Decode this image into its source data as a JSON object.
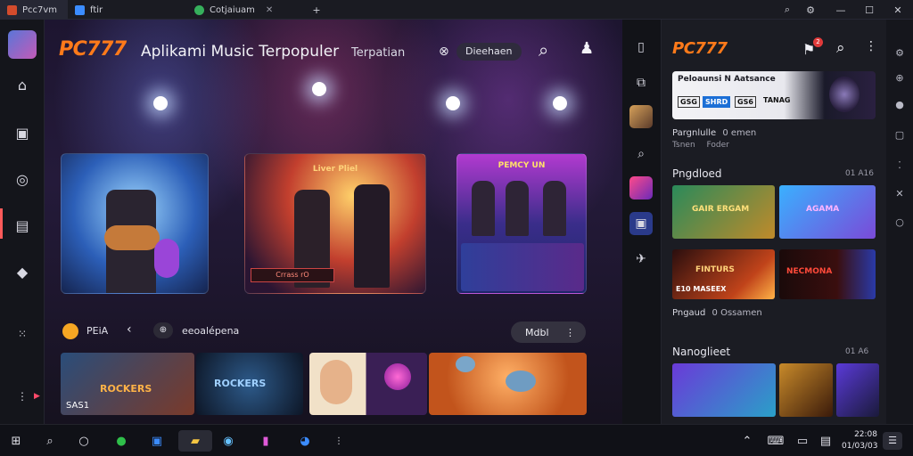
{
  "browser": {
    "tabs": [
      {
        "label": "Pcc7vm",
        "active": true
      },
      {
        "label": "ftir",
        "active": false
      },
      {
        "label": "Cotjaiuam",
        "active": false
      }
    ],
    "new_tab_icon": "plus-icon"
  },
  "window_controls": {
    "search": "search-icon",
    "settings": "gear-icon",
    "minimize": "minimize-icon",
    "maximize": "maximize-icon",
    "close": "close-icon"
  },
  "main": {
    "brand": "PC777",
    "title": "Aplikami Music Terpopuler",
    "subtitle_link": "Terpatian",
    "pill_label": "Dieehaen",
    "featured": [
      {
        "title": "",
        "name": "banner-guitarist"
      },
      {
        "title": "Liver Pliel",
        "footer": "Crrass rO",
        "name": "banner-concert"
      },
      {
        "title": "PEMCY UN",
        "name": "banner-band"
      }
    ],
    "filter_bar": {
      "category_label": "PEiA",
      "chip_label": "eeoalépena",
      "more_button": "Mdbl"
    },
    "tiles": [
      {
        "name": "tile-rockers",
        "title": "ROCKERS",
        "badge": "SAS1"
      },
      {
        "name": "tile-rock-concert",
        "title": "ROCKERS"
      },
      {
        "name": "tile-cartoon"
      },
      {
        "name": "tile-orange-creature"
      }
    ]
  },
  "panel": {
    "brand": "PC777",
    "notification_count": "2",
    "promo": {
      "headline": "Peloaunsi N Aatsance",
      "chips": [
        "GSG",
        "SHRD",
        "GS6",
        "TANAG"
      ]
    },
    "meta_row_1": {
      "line1": "Pargnlulle",
      "extra": "0 emen",
      "line2": "Tsnen",
      "line3": "Foder"
    },
    "sections": [
      {
        "title": "Pngdloed",
        "meta": "01 A16"
      },
      {
        "title": "Nanoglieet",
        "meta": "01 A6"
      }
    ],
    "tiles_row1": [
      {
        "name": "tile-game-remix",
        "title": "GAIR ERGAM"
      },
      {
        "name": "tile-blue-fantasy",
        "title": "AGAMA"
      }
    ],
    "tiles_row2": [
      {
        "name": "tile-fire-fights",
        "title": "FINTURS",
        "sub": "E10 MASEEX"
      },
      {
        "name": "tile-red-monster",
        "title": "NECMONA"
      }
    ],
    "meta_row_2": {
      "line1": "Pngaud",
      "extra": "0 Ossamen"
    },
    "tiles_row3": [
      {
        "name": "tile-heroes"
      },
      {
        "name": "tile-warrior"
      },
      {
        "name": "tile-hooded"
      }
    ]
  },
  "taskbar": {
    "clock_time": "22:08",
    "clock_date": "01/03/03",
    "apps": [
      "windows-icon",
      "search-icon",
      "circle-icon",
      "chrome-icon",
      "store-icon",
      "folder-icon",
      "circle-app-icon",
      "media-icon",
      "edge-icon",
      "more-dots-icon"
    ],
    "tray": [
      "chevron-up-icon",
      "keyboard-icon",
      "battery-icon",
      "notification-icon"
    ]
  }
}
